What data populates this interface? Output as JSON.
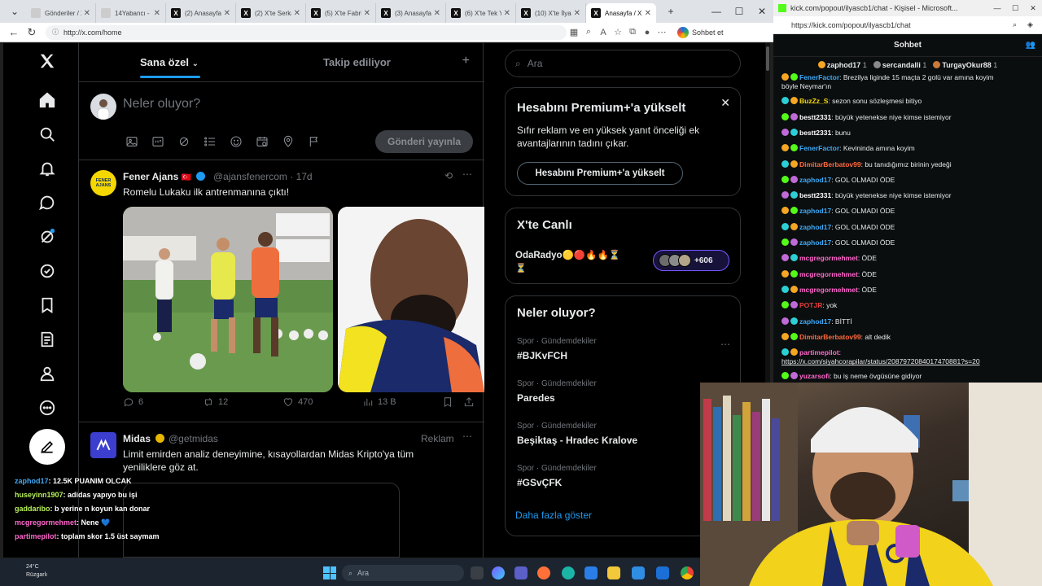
{
  "browser": {
    "tabs": [
      {
        "label": "Gönderiler / X"
      },
      {
        "label": "14Yabancı - X"
      },
      {
        "label": "(2) Anasayfa /"
      },
      {
        "label": "(2) X'te Serka"
      },
      {
        "label": "(5) X'te Fabric"
      },
      {
        "label": "(3) Anasayfa /"
      },
      {
        "label": "(6) X'te Tek Yo"
      },
      {
        "label": "(10) X'te İlyas"
      },
      {
        "label": "Anasayfa / X",
        "active": true
      }
    ],
    "url": "http://x.com/home",
    "sync_label": "Sohbet et"
  },
  "x": {
    "tabs": {
      "for_you": "Sana özel",
      "following": "Takip ediliyor"
    },
    "composer": {
      "placeholder": "Neler oluyor?",
      "post_button": "Gönderi yayınla"
    },
    "tweet1": {
      "name": "Fener Ajans",
      "flag": "🇹🇷",
      "handle": "@ajansfenercom",
      "time": "· 17d",
      "text": "Romelu Lukaku ilk antrenmanına çıktı!",
      "replies": "6",
      "reposts": "12",
      "likes": "470",
      "views": "13 B",
      "avatar_text": "FENER AJANS"
    },
    "tweet2": {
      "name": "Midas",
      "handle": "@getmidas",
      "ad_label": "Reklam",
      "text": "Limit emirden analiz deneyimine, kısayollardan Midas Kripto'ya tüm yeniliklere göz at."
    },
    "search_placeholder": "Ara",
    "premium": {
      "title": "Hesabını Premium+'a yükselt",
      "body": "Sıfır reklam ve en yüksek yanıt önceliği ek avantajlarının tadını çıkar.",
      "button": "Hesabını Premium+'a yükselt"
    },
    "live": {
      "title": "X'te Canlı",
      "host": "OdaRadyo🟡🔴🔥🔥⏳",
      "host_line2": "⏳",
      "listeners": "+606"
    },
    "trends": {
      "title": "Neler oluyor?",
      "items": [
        {
          "category": "Spor · Gündemdekiler",
          "name": "#BJKvFCH"
        },
        {
          "category": "Spor · Gündemdekiler",
          "name": "Paredes"
        },
        {
          "category": "Spor · Gündemdekiler",
          "name": "Beşiktaş - Hradec Kralove"
        },
        {
          "category": "Spor · Gündemdekiler",
          "name": "#GSvÇFK"
        }
      ],
      "show_more": "Daha fazla göster"
    }
  },
  "overlay_chat": [
    {
      "user": "zaphod17",
      "text": ": 12.5K PUANIM OLCAK",
      "color": "#3fa9f5"
    },
    {
      "user": "huseyinn1907",
      "text": ": adidas yapıyo bu işi",
      "color": "#b6f05a"
    },
    {
      "user": "gaddaribo",
      "text": ": b yerine n koyun kan donar",
      "color": "#b6f05a"
    },
    {
      "user": "mcgregormehmet",
      "text": ": Nene 💙",
      "color": "#ff66cc"
    },
    {
      "user": "partimepilot",
      "text": ": toplam skor 1.5 üst saymam",
      "color": "#ff66cc"
    }
  ],
  "kick": {
    "window_title": "kick.com/popout/ilyascb1/chat - Kişisel - Microsoft...",
    "url": "https://kick.com/popout/ilyascb1/chat",
    "header": "Sohbet",
    "pinned": [
      {
        "user": "zaphod17",
        "count": "1"
      },
      {
        "user": "sercandalli",
        "count": "1"
      },
      {
        "user": "TurgayOkur88",
        "count": "1"
      }
    ],
    "messages": [
      {
        "user": "FenerFactor",
        "text": ": Brezilya liginde 15 maçta 2 golü var amına koyim",
        "color": "#3fa9f5",
        "cont": "böyle Neymar'ın"
      },
      {
        "user": "BuzZz_S",
        "text": ": sezon sonu sözleşmesi bitiyo",
        "color": "#f5d90a"
      },
      {
        "user": "bestt2331",
        "text": ": büyük yetenekse niye kimse istemiyor",
        "color": "#ffffff"
      },
      {
        "user": "bestt2331",
        "text": ": bunu",
        "color": "#ffffff"
      },
      {
        "user": "FenerFactor",
        "text": ": Kevininda amına koyim",
        "color": "#3fa9f5"
      },
      {
        "user": "DimitarBerbatov99",
        "text": ": bu tanıdığımız birinin yedeği",
        "color": "#ff6a3d"
      },
      {
        "user": "zaphod17",
        "text": ": GOL OLMADI ÖDE",
        "color": "#3fa9f5"
      },
      {
        "user": "bestt2331",
        "text": ": büyük yetenekse niye kimse istemiyor",
        "color": "#ffffff"
      },
      {
        "user": "zaphod17",
        "text": ": GOL OLMADI ÖDE",
        "color": "#3fa9f5"
      },
      {
        "user": "zaphod17",
        "text": ": GOL OLMADI ÖDE",
        "color": "#3fa9f5"
      },
      {
        "user": "zaphod17",
        "text": ": GOL OLMADI ÖDE",
        "color": "#3fa9f5"
      },
      {
        "user": "mcgregormehmet",
        "text": ": ÖDE",
        "color": "#ff66cc"
      },
      {
        "user": "mcgregormehmet",
        "text": ": ÖDE",
        "color": "#ff66cc"
      },
      {
        "user": "mcgregormehmet",
        "text": ": ÖDE",
        "color": "#ff66cc"
      },
      {
        "user": "POTJR",
        "text": ": yok",
        "color": "#e23b3b"
      },
      {
        "user": "zaphod17",
        "text": ": BİTTİ",
        "color": "#3fa9f5"
      },
      {
        "user": "DimitarBerbatov99",
        "text": ": alt dedik",
        "color": "#ff6a3d"
      },
      {
        "user": "partimepilot",
        "text": ":",
        "color": "#ff66cc",
        "cont": "https://x.com/siyahcorapilar/status/2087972084017470881?s=20"
      },
      {
        "user": "yuzarsofi",
        "text": ": bu iş neme övgüsüne gidiyor",
        "color": "#ff66cc"
      }
    ]
  },
  "taskbar": {
    "weather_temp": "24°C",
    "weather_desc": "Rüzgarlı",
    "search": "Ara"
  }
}
